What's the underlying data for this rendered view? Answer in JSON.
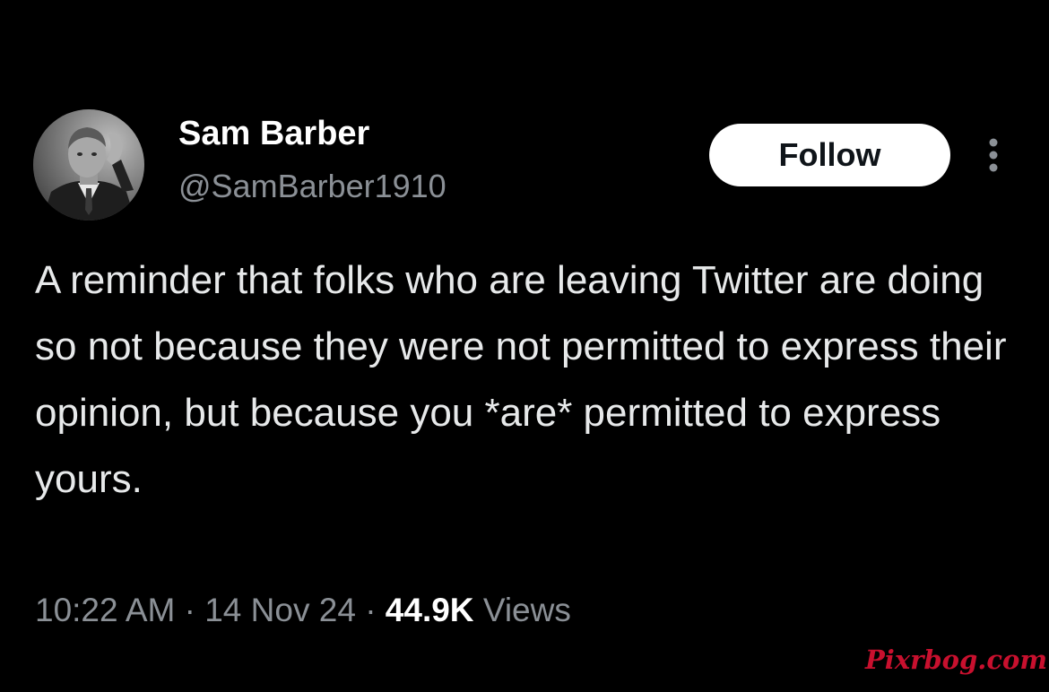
{
  "author": {
    "name": "Sam Barber",
    "handle": "@SamBarber1910"
  },
  "follow_button": {
    "label": "Follow"
  },
  "more_menu": {
    "icon": "more-vertical-icon"
  },
  "tweet": {
    "text": "A reminder that folks who are leaving Twitter are doing so not because they were not permitted to express their opinion, but because you *are* permitted to express yours."
  },
  "meta": {
    "time": "10:22 AM",
    "separator": "·",
    "date": "14 Nov 24",
    "views_count": "44.9K",
    "views_label": "Views"
  },
  "watermark": {
    "text": "Pixrbog.com"
  },
  "colors": {
    "background": "#000000",
    "primary_text": "#e7e9ea",
    "secondary_text": "#8b9096",
    "follow_bg": "#ffffff",
    "watermark": "#c8102e"
  }
}
